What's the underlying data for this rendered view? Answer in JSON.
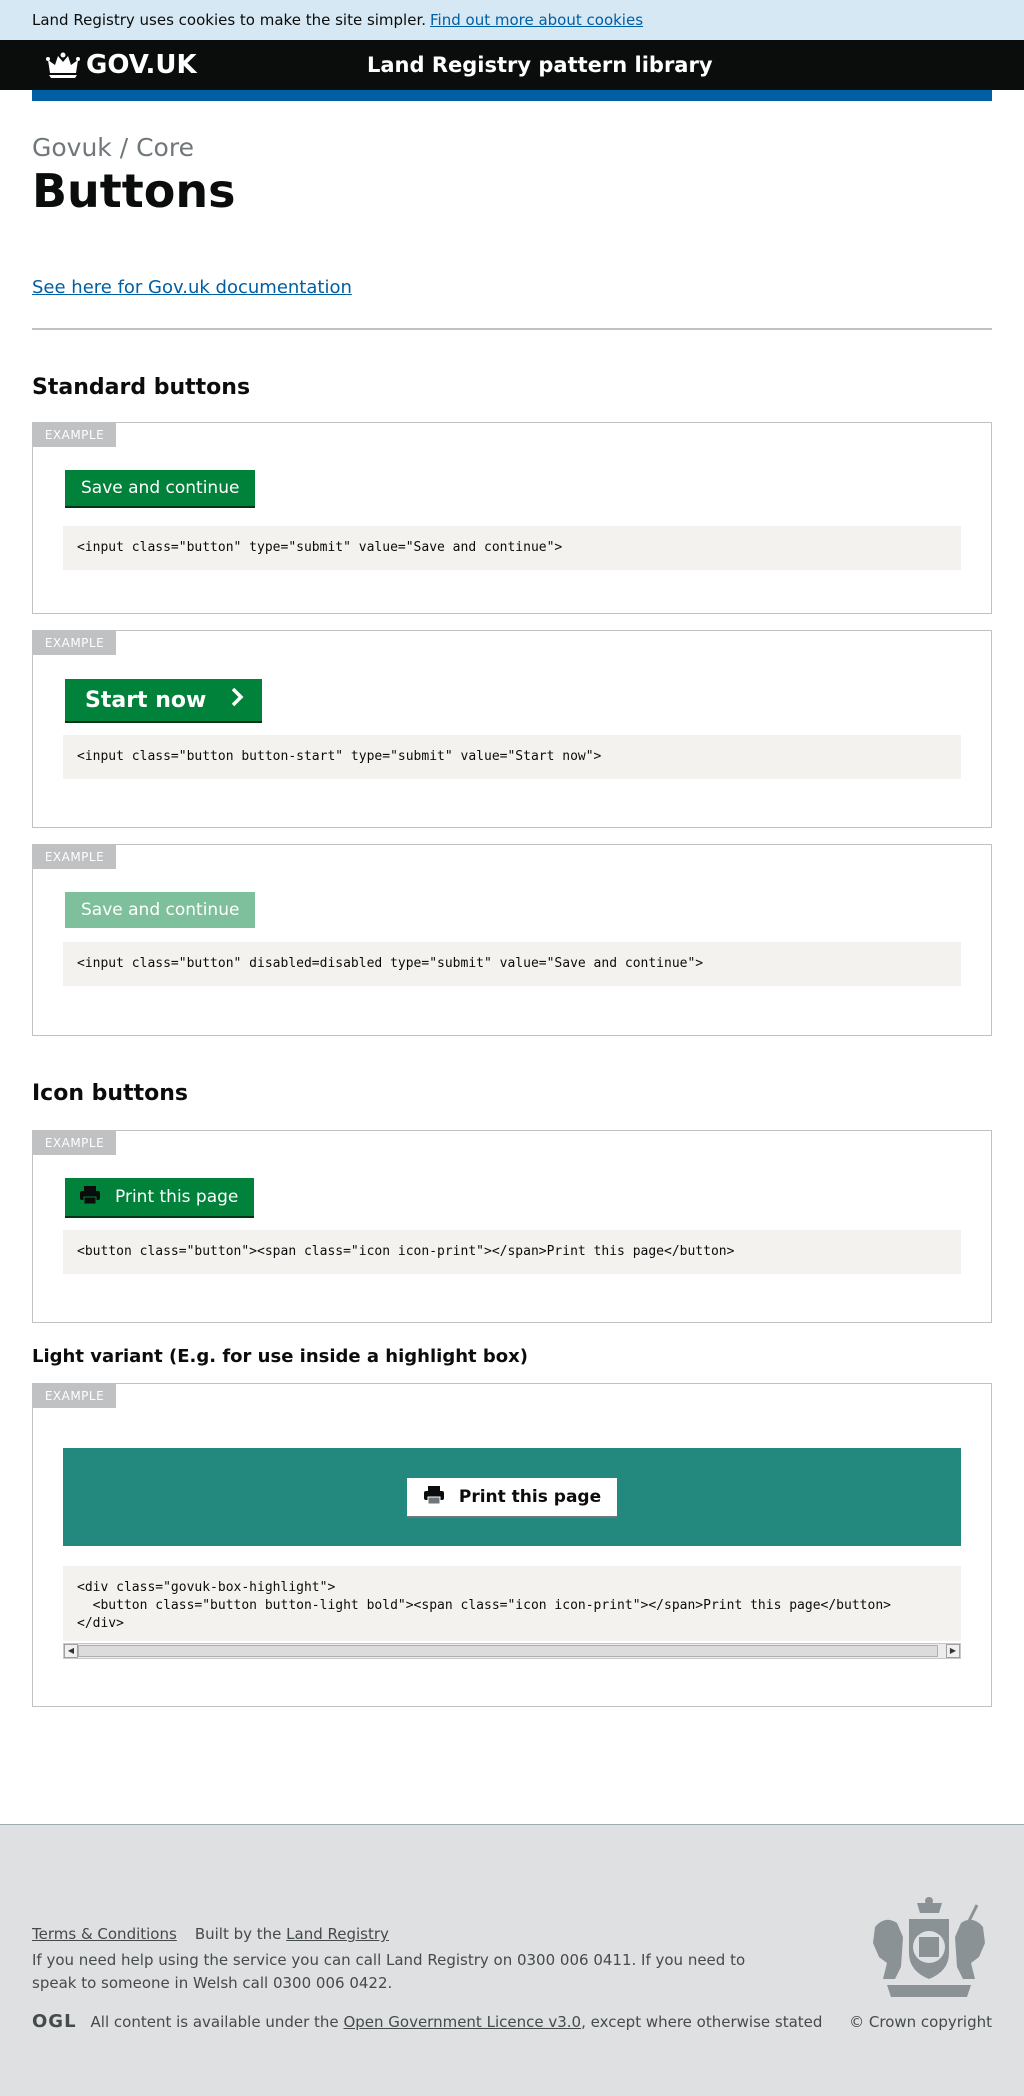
{
  "cookie_banner": {
    "text": "Land Registry uses cookies to make the site simpler.",
    "link": "Find out more about cookies"
  },
  "header": {
    "logo_text": "GOV.UK",
    "service_name": "Land Registry pattern library"
  },
  "page": {
    "caption": "Govuk / Core",
    "title": "Buttons",
    "doc_link": "See here for Gov.uk documentation",
    "example_tag": "EXAMPLE"
  },
  "standard": {
    "heading": "Standard buttons",
    "save_label": "Save and continue",
    "save_code": "<input class=\"button\" type=\"submit\" value=\"Save and continue\">",
    "start_label": "Start now",
    "start_code": "<input class=\"button button-start\" type=\"submit\" value=\"Start now\">",
    "disabled_label": "Save and continue",
    "disabled_code": "<input class=\"button\" disabled=disabled type=\"submit\" value=\"Save and continue\">"
  },
  "icon_buttons": {
    "heading": "Icon buttons",
    "print_label": "Print this page",
    "print_code": "<button class=\"button\"><span class=\"icon icon-print\"></span>Print this page</button>",
    "light_heading": "Light variant (E.g. for use inside a highlight box)",
    "light_label": "Print this page",
    "light_code": "<div class=\"govuk-box-highlight\">\n  <button class=\"button button-light bold\"><span class=\"icon icon-print\"></span>Print this page</button>\n</div>"
  },
  "footer": {
    "terms": "Terms & Conditions",
    "built_by": "Built by the",
    "built_by_link": "Land Registry",
    "help_text": "If you need help using the service you can call Land Registry on 0300 006 0411. If you need to speak to someone in Welsh call 0300 006 0422.",
    "ogl": "OGL",
    "licence_prefix": "All content is available under the",
    "licence_link": "Open Government Licence v3.0",
    "licence_suffix": ", except where otherwise stated",
    "copyright": "© Crown copyright"
  },
  "colors": {
    "button_green": "#00823b",
    "link_blue": "#005ea5",
    "highlight_teal": "#23897f"
  }
}
